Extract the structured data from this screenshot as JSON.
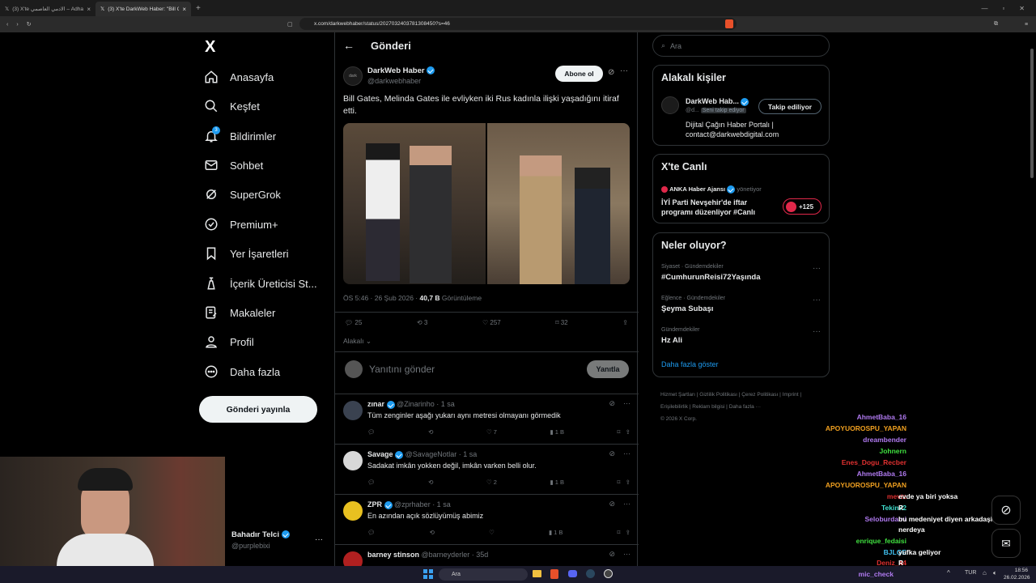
{
  "browser": {
    "tabs": [
      {
        "label": "(3) X'te الادمي العاصمي – Adham🔴🔴"
      },
      {
        "label": "(3) X'te DarkWeb Haber: \"Bill Gat..."
      }
    ],
    "url": "x.com/darkwebhaber/status/2027032403781308450?s=46"
  },
  "sidebar": {
    "logo": "X",
    "items": [
      {
        "label": "Anasayfa",
        "icon": "home-icon"
      },
      {
        "label": "Keşfet",
        "icon": "search-icon"
      },
      {
        "label": "Bildirimler",
        "icon": "bell-icon",
        "badge": "3"
      },
      {
        "label": "Sohbet",
        "icon": "mail-icon"
      },
      {
        "label": "SuperGrok",
        "icon": "grok-icon"
      },
      {
        "label": "Premium+",
        "icon": "premium-icon"
      },
      {
        "label": "Yer İşaretleri",
        "icon": "bookmark-icon"
      },
      {
        "label": "İçerik Üreticisi St...",
        "icon": "creator-icon"
      },
      {
        "label": "Makaleler",
        "icon": "article-icon"
      },
      {
        "label": "Profil",
        "icon": "profile-icon"
      },
      {
        "label": "Daha fazla",
        "icon": "more-icon"
      }
    ],
    "post_button": "Gönderi yayınla",
    "account": {
      "name": "Bahadır Telci",
      "handle": "@purplebixi"
    }
  },
  "main": {
    "header": "Gönderi",
    "tweet": {
      "author": "DarkWeb Haber",
      "handle": "@darkwebhaber",
      "subscribe": "Abone ol",
      "text": "Bill Gates, Melinda Gates ile evliyken iki Rus kadınla ilişki yaşadığını itiraf etti.",
      "time": "ÖS 5:46 · 26 Şub 2026 · ",
      "views": "40,7 B",
      "views_label": " Görüntüleme",
      "replies": "25",
      "reposts": "3",
      "likes": "257",
      "bookmarks": "32",
      "relevance": "Alakalı"
    },
    "reply_box": {
      "placeholder": "Yanıtını gönder",
      "button": "Yanıtla"
    },
    "replies": [
      {
        "name": "zınar",
        "handle": "@Zinarinho · 1 sa",
        "text": "Tüm zenginler aşağı yukarı aynı metresi olmayanı görmedik",
        "likes": "7",
        "views": "1 B",
        "color": "#3a4250"
      },
      {
        "name": "Savage",
        "handle": "@SavageNotlar · 1 sa",
        "text": "Sadakat imkân yokken değil, imkân varken belli olur.",
        "likes": "2",
        "views": "1 B",
        "color": "#d8d8d8"
      },
      {
        "name": "ZPR",
        "handle": "@zprhaber · 1 sa",
        "text": "En azından açık sözlüyümüş abimiz",
        "likes": "",
        "views": "1 B",
        "color": "#e8c020"
      },
      {
        "name": "barney stinson",
        "handle": "@barneyderler · 35d",
        "text": "",
        "likes": "",
        "views": "",
        "color": "#b02020"
      }
    ]
  },
  "right": {
    "search_placeholder": "Ara",
    "related": {
      "title": "Alakalı kişiler",
      "name": "DarkWeb Hab...",
      "handle": "@d...",
      "follows_you": "Seni takip ediyor",
      "button": "Takip ediliyor",
      "bio": "Dijital Çağın Haber Portalı | contact@darkwebdigital.com"
    },
    "live": {
      "title": "X'te Canlı",
      "host": "ANKA Haber Ajansı",
      "host_suffix": "yönetiyor",
      "text": "İYİ Parti Nevşehir'de iftar programı düzenliyor #Canlı",
      "count": "+125"
    },
    "trends": {
      "title": "Neler oluyor?",
      "items": [
        {
          "context": "Siyaset · Gündemdekiler",
          "topic": "#CumhurunReisi72Yaşında"
        },
        {
          "context": "Eğlence · Gündemdekiler",
          "topic": "Şeyma Subaşı"
        },
        {
          "context": "Gündemdekiler",
          "topic": "Hz Ali"
        }
      ],
      "more": "Daha fazla göster"
    },
    "footer": [
      "Hizmet Şartları",
      "Gizlilik Politikası",
      "Çerez Politikası",
      "Imprint",
      "Erişilebilirlik",
      "Reklam bilgisi",
      "Daha fazla ···",
      "© 2026 X Corp."
    ]
  },
  "chat": [
    {
      "user": "AhmetBaba_16",
      "msg": "",
      "color": "#b07af0"
    },
    {
      "user": "APOYUOROSPU_YAPAN",
      "msg": "",
      "color": "#f0a020"
    },
    {
      "user": "dreambender",
      "msg": "",
      "color": "#b07af0"
    },
    {
      "user": "Johnern",
      "msg": "",
      "color": "#40e040"
    },
    {
      "user": "Enes_Dogu_Recber",
      "msg": "",
      "color": "#e03030"
    },
    {
      "user": "AhmetBaba_16",
      "msg": "",
      "color": "#b07af0"
    },
    {
      "user": "APOYUOROSPU_YAPAN",
      "msg": "",
      "color": "#f0a020"
    },
    {
      "user": "mevtz",
      "msg": "evde ya biri yoksa",
      "color": "#e03030"
    },
    {
      "user": "Tekin72",
      "msg": "R",
      "color": "#40e0d0"
    },
    {
      "user": "Seloburdami",
      "msg": "bu medeniyet diyen arkadaşlar",
      "color": "#b07af0"
    },
    {
      "user": "",
      "msg": "nerdeya",
      "color": "#ffffff"
    },
    {
      "user": "enrique_fedaisi",
      "msg": "",
      "color": "#40e040"
    },
    {
      "user": "BJLGE",
      "msg": "yufka geliyor",
      "color": "#40c0f0"
    },
    {
      "user": "Deniz_44",
      "msg": "R",
      "color": "#e03030"
    },
    {
      "user": "mic_check",
      "msg": "",
      "color": "#b07af0"
    }
  ],
  "taskbar": {
    "search": "Ara",
    "lang": "TUR",
    "time": "18:56",
    "date": "26.02.2026"
  }
}
